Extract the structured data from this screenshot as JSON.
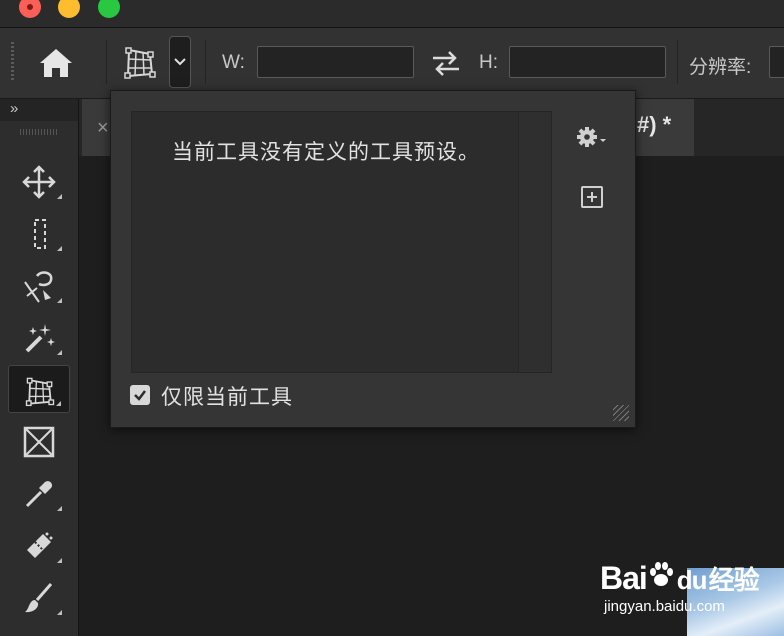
{
  "window": {
    "traffic_lights": [
      "close",
      "minimize",
      "zoom"
    ]
  },
  "optionsbar": {
    "home_icon": "home-icon",
    "tool_icon": "perspective-crop-icon",
    "width_label": "W:",
    "width_value": "",
    "swap_icon": "swap-arrows-icon",
    "height_label": "H:",
    "height_value": "",
    "resolution_label": "分辨率:",
    "resolution_value": ""
  },
  "toolspanel": {
    "collapse_label": "»",
    "tools": [
      {
        "name": "move-tool",
        "icon": "move-icon",
        "active": false
      },
      {
        "name": "marquee-tool",
        "icon": "rect-marquee-icon",
        "active": false
      },
      {
        "name": "lasso-tool",
        "icon": "magnetic-lasso-icon",
        "active": false
      },
      {
        "name": "magic-wand-tool",
        "icon": "magic-wand-icon",
        "active": false
      },
      {
        "name": "perspective-crop-tool",
        "icon": "perspective-crop-icon",
        "active": true
      },
      {
        "name": "frame-tool",
        "icon": "frame-icon",
        "active": false
      },
      {
        "name": "eyedropper-tool",
        "icon": "eyedropper-icon",
        "active": false
      },
      {
        "name": "healing-brush-tool",
        "icon": "bandage-icon",
        "active": false
      },
      {
        "name": "brush-tool",
        "icon": "brush-icon",
        "active": false
      }
    ]
  },
  "document": {
    "tab_close": "×",
    "tab_title": "#) *"
  },
  "preset_popup": {
    "empty_message": "当前工具没有定义的工具预设。",
    "gear_icon": "gear-icon",
    "new_preset_icon": "new-preset-icon",
    "current_tool_only_checked": true,
    "current_tool_only_label": "仅限当前工具"
  },
  "watermark": {
    "brand": "Bai",
    "brand_suffix": "du",
    "brand_cn": "经验",
    "url": "jingyan.baidu.com"
  }
}
